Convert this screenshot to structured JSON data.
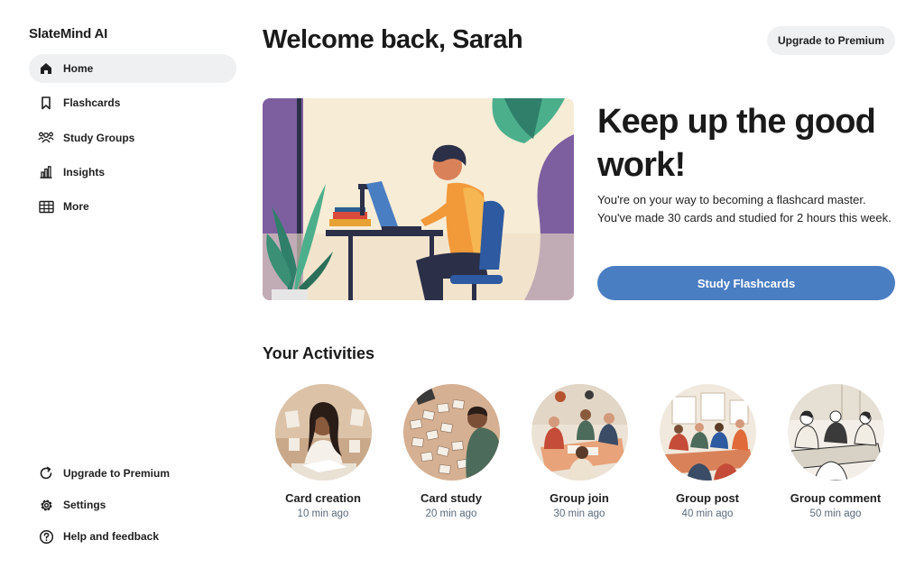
{
  "app": {
    "name": "SlateMind AI"
  },
  "sidebar": {
    "items": [
      {
        "label": "Home",
        "icon": "home-icon",
        "active": true
      },
      {
        "label": "Flashcards",
        "icon": "bookmark-icon"
      },
      {
        "label": "Study Groups",
        "icon": "group-icon"
      },
      {
        "label": "Insights",
        "icon": "bar-chart-icon"
      },
      {
        "label": "More",
        "icon": "grid-icon"
      }
    ],
    "bottom_items": [
      {
        "label": "Upgrade to Premium",
        "icon": "refresh-icon"
      },
      {
        "label": "Settings",
        "icon": "gear-icon"
      },
      {
        "label": "Help and feedback",
        "icon": "help-icon"
      }
    ]
  },
  "header": {
    "welcome": "Welcome back, Sarah",
    "upgrade_label": "Upgrade to Premium"
  },
  "hero": {
    "title": "Keep up the good work!",
    "text": "You're on your way to becoming a flashcard master. You've made 30 cards and studied for 2 hours this week.",
    "cta_label": "Study Flashcards"
  },
  "activities": {
    "title": "Your Activities",
    "items": [
      {
        "name": "Card creation",
        "time": "10 min ago"
      },
      {
        "name": "Card study",
        "time": "20 min ago"
      },
      {
        "name": "Group join",
        "time": "30 min ago"
      },
      {
        "name": "Group post",
        "time": "40 min ago"
      },
      {
        "name": "Group comment",
        "time": "50 min ago"
      }
    ]
  },
  "colors": {
    "accent": "#4a7ec2",
    "nav_active_bg": "#eef0f1",
    "muted_text": "#5a6b7b"
  }
}
